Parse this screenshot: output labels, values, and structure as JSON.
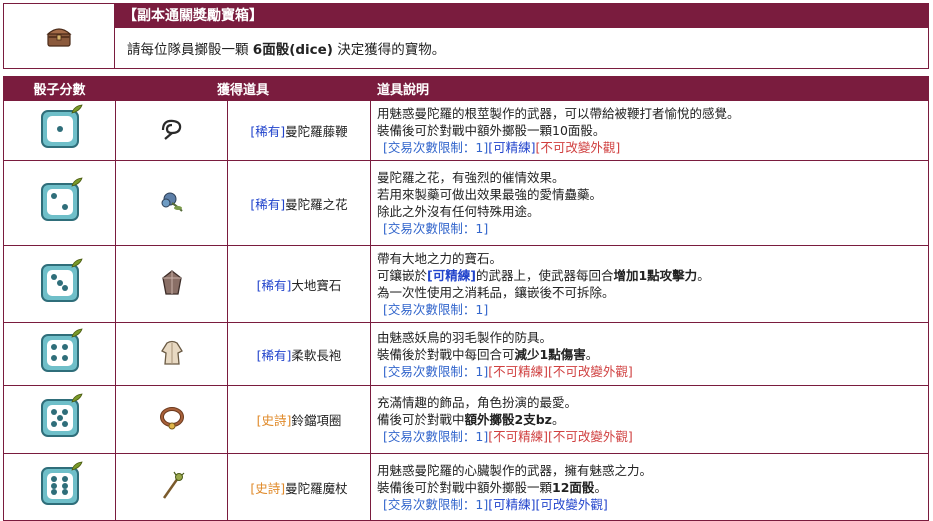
{
  "header": {
    "title": "【副本通關獎勵寶箱】",
    "text_pre": "請每位隊員擲骰一顆 ",
    "text_bold": "6面骰(dice)",
    "text_post": " 決定獲得的寶物。",
    "icon": "treasure-chest-icon"
  },
  "columns": {
    "dice": "骰子分數",
    "item": "獲得道具",
    "desc": "道具說明"
  },
  "colors": {
    "accent": "#7a1c3e",
    "rare": "#2244cc",
    "epic": "#e08a2a",
    "trade": "#3366cc",
    "red": "#d04040"
  },
  "rows": [
    {
      "dice": 1,
      "icon": "whip-icon",
      "tag": "[稀有]",
      "tag_type": "rare",
      "name": "曼陀羅藤鞭",
      "lines": [
        "用魅惑曼陀羅的根莖製作的武器，可以帶給被鞭打者愉悅的感覺。",
        "裝備後可於對戰中額外擲骰一顆10面骰。"
      ],
      "trade_limit": "[交易次數限制：1]",
      "refine": "[可精練]",
      "refine_type": "blue",
      "appearance": "[不可改變外觀]",
      "appearance_type": "red"
    },
    {
      "dice": 2,
      "icon": "flower-icon",
      "tag": "[稀有]",
      "tag_type": "rare",
      "name": "曼陀羅之花",
      "lines": [
        "曼陀羅之花，有強烈的催情效果。",
        "若用來製藥可做出效果最強的愛情蠱藥。",
        "除此之外沒有任何特殊用途。"
      ],
      "trade_limit": "[交易次數限制：1]",
      "refine": "",
      "refine_type": "",
      "appearance": "",
      "appearance_type": ""
    },
    {
      "dice": 3,
      "icon": "gem-icon",
      "tag": "[稀有]",
      "tag_type": "rare",
      "name": "大地寶石",
      "lines_rich": [
        [
          {
            "t": "帶有大地之力的寶石。"
          }
        ],
        [
          {
            "t": "可鑲嵌於"
          },
          {
            "t": "[可精練]",
            "c": "blue",
            "b": true
          },
          {
            "t": "的武器上，使武器每回合"
          },
          {
            "t": "增加1點攻擊力",
            "b": true
          },
          {
            "t": "。"
          }
        ],
        [
          {
            "t": "為一次性使用之消耗品，鑲嵌後不可拆除。"
          }
        ]
      ],
      "trade_limit": "[交易次數限制：1]",
      "refine": "",
      "refine_type": "",
      "appearance": "",
      "appearance_type": ""
    },
    {
      "dice": 4,
      "icon": "robe-icon",
      "tag": "[稀有]",
      "tag_type": "rare",
      "name": "柔軟長袍",
      "lines_rich": [
        [
          {
            "t": "由魅惑妖鳥的羽毛製作的防具。"
          }
        ],
        [
          {
            "t": "裝備後於對戰中每回合可"
          },
          {
            "t": "減少1點傷害",
            "b": true
          },
          {
            "t": "。"
          }
        ]
      ],
      "trade_limit": "[交易次數限制：1]",
      "refine": "[不可精練]",
      "refine_type": "red",
      "appearance": "[不可改變外觀]",
      "appearance_type": "red"
    },
    {
      "dice": 5,
      "icon": "collar-icon",
      "tag": "[史詩]",
      "tag_type": "epic",
      "name": "鈴鐺項圈",
      "lines_rich": [
        [
          {
            "t": "充滿情趣的飾品，角色扮演的最愛。"
          }
        ],
        [
          {
            "t": "備後可於對戰中"
          },
          {
            "t": "額外擲骰2支bz",
            "b": true
          },
          {
            "t": "。"
          }
        ]
      ],
      "trade_limit": "[交易次數限制：1]",
      "refine": "[不可精練]",
      "refine_type": "red",
      "appearance": "[不可改變外觀]",
      "appearance_type": "red"
    },
    {
      "dice": 6,
      "icon": "staff-icon",
      "tag": "[史詩]",
      "tag_type": "epic",
      "name": "曼陀羅魔杖",
      "lines_rich": [
        [
          {
            "t": "用魅惑曼陀羅的心臟製作的武器，擁有魅惑之力。"
          }
        ],
        [
          {
            "t": "裝備後可於對戰中額外擲骰一顆"
          },
          {
            "t": "12面骰",
            "b": true
          },
          {
            "t": "。"
          }
        ]
      ],
      "trade_limit": "[交易次數限制：1]",
      "refine": "[可精練]",
      "refine_type": "blue",
      "appearance": "[可改變外觀]",
      "appearance_type": "blue"
    }
  ]
}
